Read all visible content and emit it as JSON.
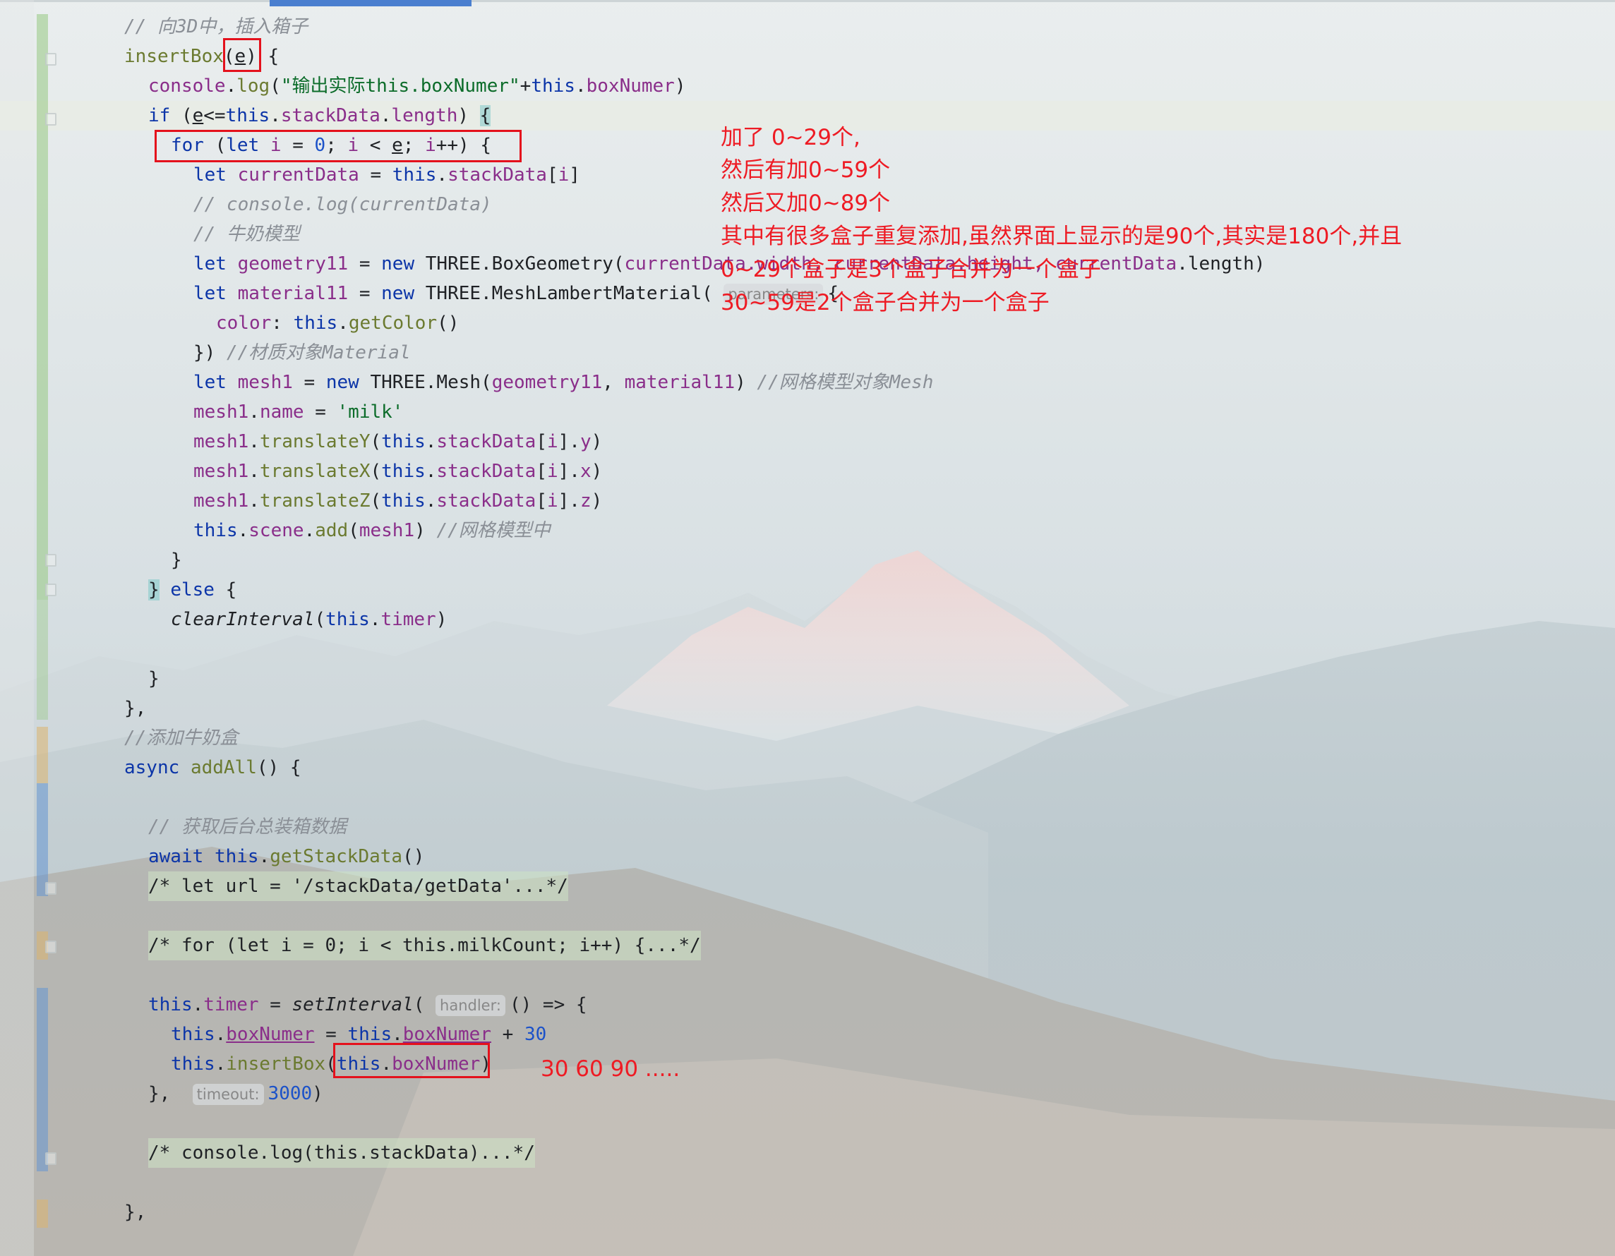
{
  "colors": {
    "annotation_red": "#e4111c",
    "keyword": "#0c35a8",
    "field": "#8a2e8a",
    "string": "#0c6c2a",
    "number": "#1c52c9",
    "comment": "#8a8f96",
    "tab_accent": "#4a7fcf"
  },
  "code": {
    "l1": "// 向3D中，插入箱子",
    "l2_fn": "insertBox",
    "l2_param": "e",
    "l3_obj": "console",
    "l3_method": "log",
    "l3_str": "\"输出实际this.boxNumer\"",
    "l3_field": "boxNumer",
    "l4_field": "stackData",
    "l5_zero": "0",
    "l6_var": "currentData",
    "l6_field": "stackData",
    "l7": "// console.log(currentData)",
    "l8": "// 牛奶模型",
    "l9_var": "geometry11",
    "l9_cls": "THREE.BoxGeometry",
    "l9_args": "currentData.width, currentData.height, currentData",
    "l9_tail": ".length)",
    "l10_var": "material11",
    "l10_cls": "THREE.MeshLambertMaterial",
    "l10_hint": "parameters:",
    "l11_key": "color",
    "l11_method": "getColor",
    "l12_comment": "//材质对象Material",
    "l13_var": "mesh1",
    "l13_cls": "THREE.Mesh",
    "l13_a1": "geometry11",
    "l13_a2": "material11",
    "l13_comment": "//网格模型对象Mesh",
    "l14_str": "'milk'",
    "l15_method": "translateY",
    "l16_method": "translateX",
    "l17_method": "translateZ",
    "l18_comment": "//网格模型中",
    "l21_fn": "clearInterval",
    "l21_field": "timer",
    "l25": "//添加牛奶盒",
    "l26_fn": "addAll",
    "l28": "// 获取后台总装箱数据",
    "l29_method": "getStackData",
    "l30": "/* let url = '/stackData/getData'...*/",
    "l32": "/* for (let i = 0; i < this.milkCount; i++) {...*/",
    "l34_field": "timer",
    "l34_fn": "setInterval",
    "l34_hint": "handler:",
    "l35_field": "boxNumer",
    "l35_num": "30",
    "l36_method": "insertBox",
    "l36_field": "boxNumer",
    "l37_hint": "timeout:",
    "l37_num": "3000",
    "l39": "/* console.log(this.stackData)...*/"
  },
  "annotations": {
    "note_line1": "加了 0~29个,",
    "note_line2": "然后有加0~59个",
    "note_line3": "然后又加0~89个",
    "note_line4": "其中有很多盒子重复添加,虽然界面上显示的是90个,其实是180个,并且",
    "note_line5": "0~29个盒子是3个盒子合并为一个盒子",
    "note_line6": "30~59是2个盒子合并为一个盒子",
    "sequence_note": "30 60 90 ....."
  }
}
